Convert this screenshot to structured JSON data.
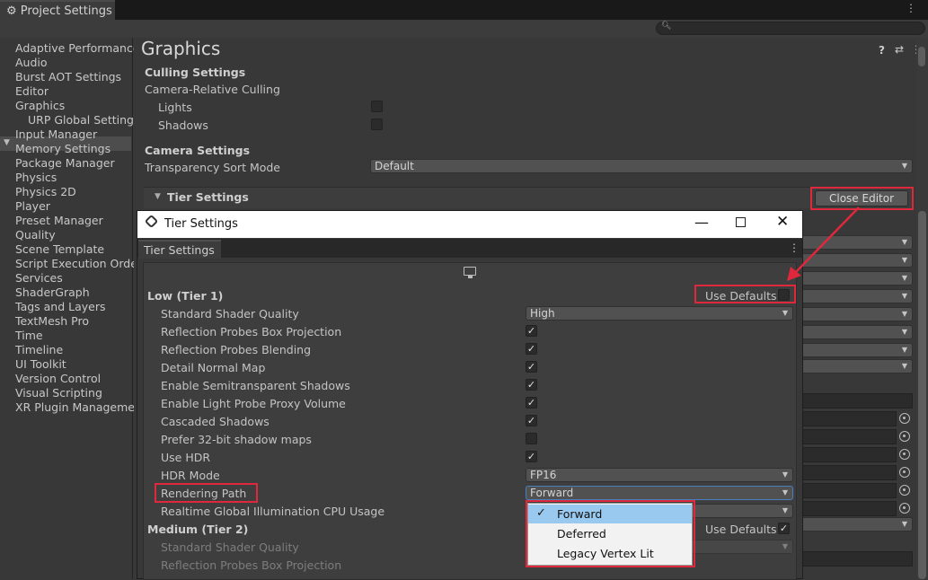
{
  "window": {
    "tab_title": "Project Settings"
  },
  "sidebar": {
    "items": [
      {
        "label": "Adaptive Performance"
      },
      {
        "label": "Audio"
      },
      {
        "label": "Burst AOT Settings"
      },
      {
        "label": "Editor"
      },
      {
        "label": "Graphics"
      },
      {
        "label": "URP Global Settings"
      },
      {
        "label": "Input Manager"
      },
      {
        "label": "Memory Settings"
      },
      {
        "label": "Package Manager"
      },
      {
        "label": "Physics"
      },
      {
        "label": "Physics 2D"
      },
      {
        "label": "Player"
      },
      {
        "label": "Preset Manager"
      },
      {
        "label": "Quality"
      },
      {
        "label": "Scene Template"
      },
      {
        "label": "Script Execution Order"
      },
      {
        "label": "Services"
      },
      {
        "label": "ShaderGraph"
      },
      {
        "label": "Tags and Layers"
      },
      {
        "label": "TextMesh Pro"
      },
      {
        "label": "Time"
      },
      {
        "label": "Timeline"
      },
      {
        "label": "UI Toolkit"
      },
      {
        "label": "Version Control"
      },
      {
        "label": "Visual Scripting"
      },
      {
        "label": "XR Plugin Management"
      }
    ],
    "selected": "Graphics"
  },
  "main": {
    "title": "Graphics",
    "culling": {
      "header": "Culling Settings",
      "sub": "Camera-Relative Culling",
      "lights": "Lights",
      "shadows": "Shadows"
    },
    "camera": {
      "header": "Camera Settings",
      "sort_label": "Transparency Sort Mode",
      "sort_value": "Default"
    },
    "tier": {
      "header": "Tier Settings",
      "close_editor": "Close Editor"
    }
  },
  "tier_window": {
    "title": "Tier Settings",
    "tab": "Tier Settings",
    "low": {
      "header": "Low (Tier 1)",
      "use_defaults": "Use Defaults",
      "rows": [
        {
          "label": "Standard Shader Quality",
          "value": "High"
        },
        {
          "label": "Reflection Probes Box Projection"
        },
        {
          "label": "Reflection Probes Blending"
        },
        {
          "label": "Detail Normal Map"
        },
        {
          "label": "Enable Semitransparent Shadows"
        },
        {
          "label": "Enable Light Probe Proxy Volume"
        },
        {
          "label": "Cascaded Shadows"
        },
        {
          "label": "Prefer 32-bit shadow maps"
        },
        {
          "label": "Use HDR"
        },
        {
          "label": "HDR Mode",
          "value": "FP16"
        },
        {
          "label": "Rendering Path",
          "value": "Forward"
        },
        {
          "label": "Realtime Global Illumination CPU Usage"
        }
      ]
    },
    "medium": {
      "header": "Medium (Tier 2)",
      "use_defaults": "Use Defaults",
      "rows": [
        {
          "label": "Standard Shader Quality"
        },
        {
          "label": "Reflection Probes Box Projection"
        }
      ]
    }
  },
  "rendering_path_popup": {
    "options": [
      "Forward",
      "Deferred",
      "Legacy Vertex Lit"
    ],
    "selected": "Forward"
  },
  "colors": {
    "accent_red": "#e0283c",
    "selection_blue": "#99c9ef"
  }
}
